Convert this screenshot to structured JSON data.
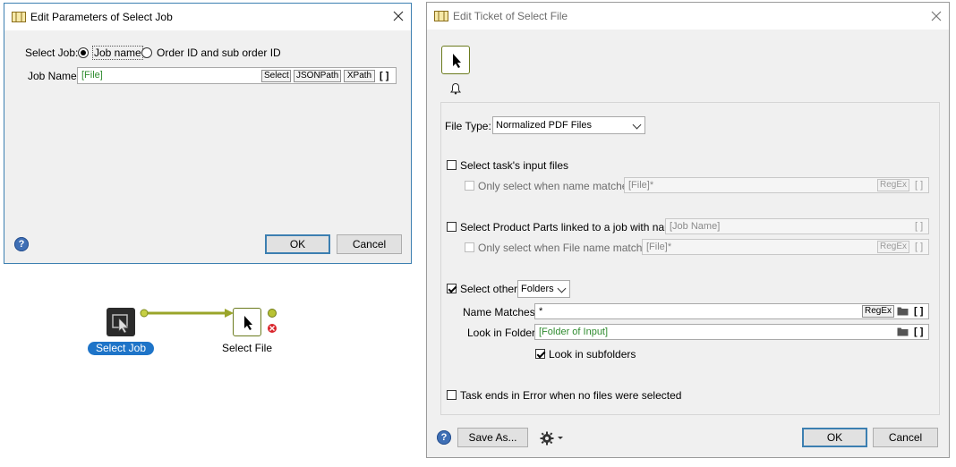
{
  "left_dialog": {
    "title": "Edit Parameters of Select Job",
    "select_job_label": "Select Job:",
    "radio_job_name": "Job name",
    "radio_order_id": "Order ID and sub order ID",
    "job_name_label": "Job Name:",
    "job_name_value": "[File]",
    "btn_select": "Select",
    "btn_jsonpath": "JSONPath",
    "btn_xpath": "XPath",
    "bracket": "[ ]",
    "help": "?",
    "ok": "OK",
    "cancel": "Cancel"
  },
  "flow": {
    "node1_label": "Select Job",
    "node2_label": "Select File"
  },
  "right_dialog": {
    "title": "Edit Ticket of Select File",
    "file_type_label": "File Type:",
    "file_type_value": "Normalized PDF Files",
    "select_input_files": "Select task's input files",
    "only_select_name": "Only select when name matches:",
    "input_files_pattern": "[File]*",
    "regex": "RegEx",
    "bracket": "[ ]",
    "select_product_parts": "Select Product Parts linked to a job with name:",
    "job_name_field": "[Job Name]",
    "only_select_file_name": "Only select when File name matches:",
    "product_parts_pattern": "[File]*",
    "select_other": "Select other",
    "select_other_value": "Folders",
    "name_matches_label": "Name Matches:",
    "name_matches_value": "*",
    "look_in_folder_label": "Look in Folder:",
    "look_in_folder_value": "[Folder of Input]",
    "look_in_subfolders": "Look in subfolders",
    "task_ends_error": "Task ends in Error when no files were selected",
    "help": "?",
    "save_as": "Save As...",
    "ok": "OK",
    "cancel": "Cancel"
  }
}
